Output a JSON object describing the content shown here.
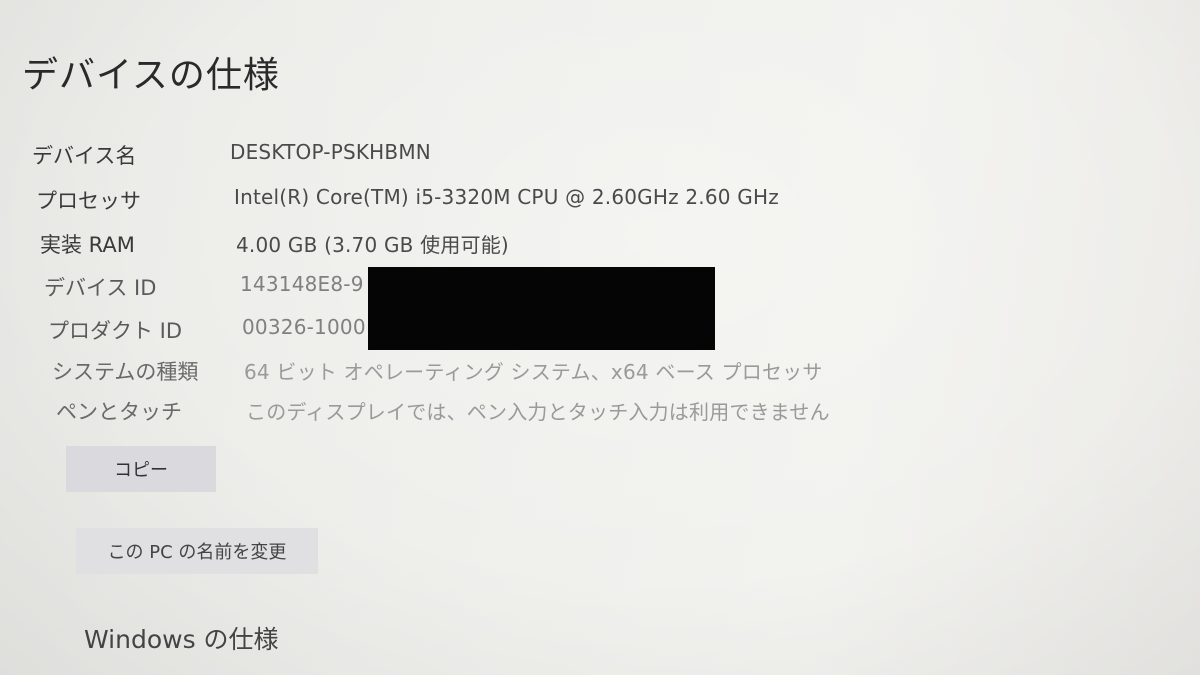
{
  "page": {
    "title": "デバイスの仕様"
  },
  "specs": [
    {
      "label": "デバイス名",
      "value": "DESKTOP-PSKHBMN"
    },
    {
      "label": "プロセッサ",
      "value": "Intel(R) Core(TM) i5-3320M CPU @ 2.60GHz   2.60 GHz"
    },
    {
      "label": "実装 RAM",
      "value": "4.00 GB (3.70 GB 使用可能)"
    },
    {
      "label": "デバイス ID",
      "value": "143148E8-9"
    },
    {
      "label": "プロダクト ID",
      "value": "00326-1000"
    },
    {
      "label": "システムの種類",
      "value": "64 ビット オペレーティング システム、x64 ベース プロセッサ"
    },
    {
      "label": "ペンとタッチ",
      "value": "このディスプレイでは、ペン入力とタッチ入力は利用できません"
    }
  ],
  "buttons": {
    "copy": "コピー",
    "rename": "この PC の名前を変更"
  },
  "windows_section": {
    "title": "Windows の仕様"
  },
  "colors": {
    "background": "#efefec",
    "button": "#dadade",
    "redaction": "#050505"
  }
}
